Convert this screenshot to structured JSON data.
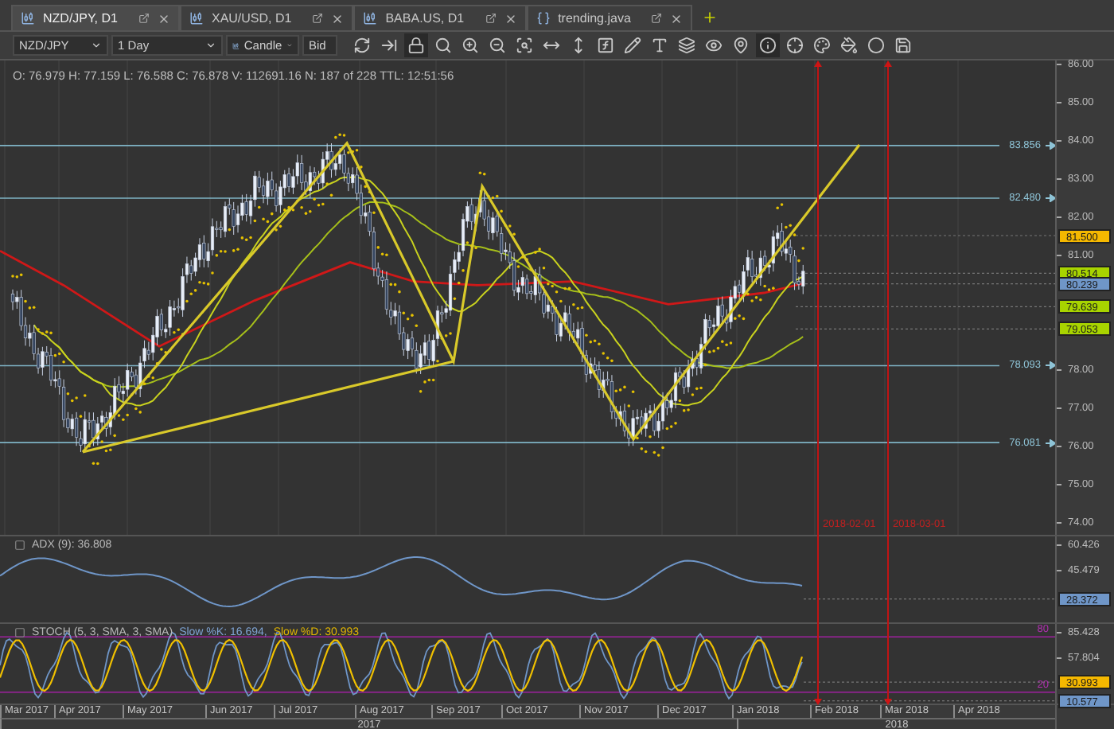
{
  "tabs": [
    {
      "kind": "chart",
      "label": "NZD/JPY, D1",
      "selected": true
    },
    {
      "kind": "chart",
      "label": "XAU/USD, D1",
      "selected": false
    },
    {
      "kind": "chart",
      "label": "BABA.US, D1",
      "selected": false
    },
    {
      "kind": "code",
      "label": "trending.java",
      "selected": false
    }
  ],
  "toolbar": {
    "instrument": "NZD/JPY",
    "period": "1 Day",
    "chart_type": "Candle",
    "price_side": "Bid",
    "tools": [
      {
        "kind": "refresh",
        "active": false
      },
      {
        "kind": "scroll-end",
        "active": false
      },
      {
        "kind": "lock",
        "active": true
      },
      {
        "kind": "zoom-fit",
        "active": false
      },
      {
        "kind": "zoom-in",
        "active": false
      },
      {
        "kind": "zoom-out",
        "active": false
      },
      {
        "kind": "zoom-area",
        "active": false
      },
      {
        "kind": "stretch-horizontal",
        "active": false
      },
      {
        "kind": "stretch-vertical",
        "active": false
      },
      {
        "kind": "indicators",
        "active": false
      },
      {
        "kind": "draw",
        "active": false
      },
      {
        "kind": "text",
        "active": false
      },
      {
        "kind": "layers",
        "active": false
      },
      {
        "kind": "visibility",
        "active": false
      },
      {
        "kind": "marker",
        "active": false
      },
      {
        "kind": "info",
        "active": true
      },
      {
        "kind": "crosshair",
        "active": false
      },
      {
        "kind": "color-scale",
        "active": false
      },
      {
        "kind": "fill",
        "active": false
      },
      {
        "kind": "circle",
        "active": false
      },
      {
        "kind": "save",
        "active": false
      }
    ]
  },
  "info_line": "O: 76.979 H: 77.159 L: 76.588 C: 76.878 V: 112691.16 N: 187 of 228 TTL: 12:51:56",
  "main_chart": {
    "price_axis": [
      "86.00",
      "85.00",
      "84.00",
      "83.00",
      "82.00",
      "81.00",
      "78.00",
      "77.00",
      "76.00",
      "75.00",
      "74.00"
    ],
    "levels": [
      "83.856",
      "82.480",
      "78.093",
      "76.081"
    ],
    "price_badges": [
      {
        "value": "81.500",
        "color": "#f5b800"
      },
      {
        "value": "80.514",
        "color": "#a8d400"
      },
      {
        "value": "80.239",
        "color": "#6f96c8"
      },
      {
        "value": "79.639",
        "color": "#a8d400"
      },
      {
        "value": "79.053",
        "color": "#a8d400"
      }
    ]
  },
  "adx": {
    "label": "ADX (9): 36.808",
    "axis": [
      "60.426",
      "45.479"
    ],
    "badges": [
      {
        "value": "28.372",
        "color": "#6f96c8"
      }
    ]
  },
  "stoch": {
    "label": "STOCH (5, 3, SMA, 3, SMA)",
    "k_label": "Slow %K: 16.694,",
    "d_label": "Slow %D: 30.993",
    "axis": [
      "85.428",
      "57.804"
    ],
    "bands": [
      "80",
      "20"
    ],
    "badges": [
      {
        "value": "30.993",
        "color": "#f5b800"
      },
      {
        "value": "10.577",
        "color": "#6f96c8"
      }
    ]
  },
  "markers": [
    "2018-02-01",
    "2018-03-01"
  ],
  "time_axis": {
    "months": [
      "Mar 2017",
      "Apr 2017",
      "May 2017",
      "Jun 2017",
      "Jul 2017",
      "Aug 2017",
      "Sep 2017",
      "Oct 2017",
      "Nov 2017",
      "Dec 2017",
      "Jan 2018",
      "Feb 2018",
      "Mar 2018",
      "Apr 2018"
    ],
    "years": [
      "2017",
      "2018"
    ]
  }
}
